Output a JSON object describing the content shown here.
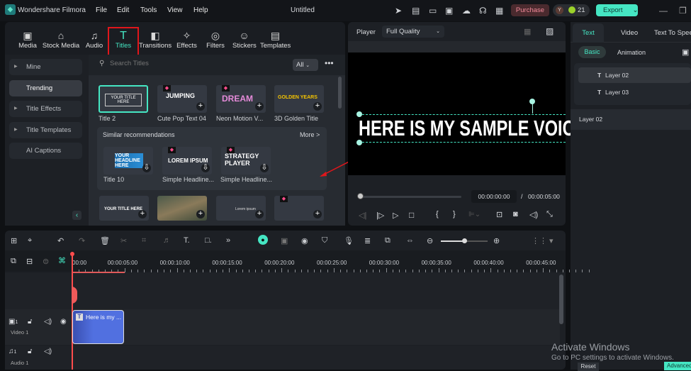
{
  "app": {
    "name": "Wondershare Filmora",
    "project_title": "Untitled",
    "menu": [
      "File",
      "Edit",
      "Tools",
      "View",
      "Help"
    ],
    "purchase_label": "Purchase",
    "avatar_letter": "Y",
    "credits": "21",
    "export_label": "Export",
    "accent": "#45e6c3"
  },
  "media_tabs": [
    {
      "label": "Media",
      "icon": "media-icon"
    },
    {
      "label": "Stock Media",
      "icon": "stock-icon"
    },
    {
      "label": "Audio",
      "icon": "music-icon"
    },
    {
      "label": "Titles",
      "icon": "text-icon",
      "selected": true
    },
    {
      "label": "Transitions",
      "icon": "transition-icon"
    },
    {
      "label": "Effects",
      "icon": "effects-icon"
    },
    {
      "label": "Filters",
      "icon": "filter-icon"
    },
    {
      "label": "Stickers",
      "icon": "sticker-icon"
    },
    {
      "label": "Templates",
      "icon": "template-icon"
    }
  ],
  "categories": [
    {
      "label": "Mine"
    },
    {
      "label": "Trending"
    },
    {
      "label": "Title Effects"
    },
    {
      "label": "Title Templates"
    },
    {
      "label": "AI Captions"
    }
  ],
  "search": {
    "placeholder": "Search Titles",
    "filter": "All"
  },
  "titles": [
    {
      "label": "Title 2",
      "preview": "YOUR TITLE HERE"
    },
    {
      "label": "Cute Pop Text 04",
      "preview": "JUMPING"
    },
    {
      "label": "Neon Motion V...",
      "preview": "DREAM"
    },
    {
      "label": "3D Golden Title",
      "preview": "GOLDEN YEARS"
    }
  ],
  "similar": {
    "heading": "Similar recommendations",
    "more": "More >",
    "items": [
      {
        "label": "Title 10",
        "preview": "YOUR HEADLINE HERE"
      },
      {
        "label": "Simple Headline...",
        "preview": "LOREM IPSUM"
      },
      {
        "label": "Simple Headline...",
        "preview": "STRATEGY PLAYER"
      }
    ]
  },
  "more_titles": [
    {
      "preview": "YOUR TITLE HERE"
    },
    {
      "preview": ""
    },
    {
      "preview": "Lorem ipsum"
    },
    {
      "preview": ""
    }
  ],
  "player": {
    "label": "Player",
    "quality": "Full Quality",
    "overlay_text": "HERE IS MY SAMPLE VOICE",
    "current_time": "00:00:00:00",
    "separator": "/",
    "total_time": "00:00:05:00"
  },
  "right_panel": {
    "tabs": [
      "Text",
      "Video",
      "Text To Speech"
    ],
    "subtabs": [
      "Basic",
      "Animation"
    ],
    "layers": [
      "Layer 02",
      "Layer 03"
    ],
    "selected_layer": "Layer 02",
    "reset": "Reset",
    "advanced": "Advanced"
  },
  "timeline": {
    "ticks": [
      "00:00",
      "00:00:05:00",
      "00:00:10:00",
      "00:00:15:00",
      "00:00:20:00",
      "00:00:25:00",
      "00:00:30:00",
      "00:00:35:00",
      "00:00:40:00",
      "00:00:45:00"
    ],
    "clip_label": "Here is my ...",
    "video_track": "Video 1",
    "audio_track": "Audio 1",
    "track_num": "1"
  },
  "watermark": {
    "title": "Activate Windows",
    "subtitle": "Go to PC settings to activate Windows."
  }
}
